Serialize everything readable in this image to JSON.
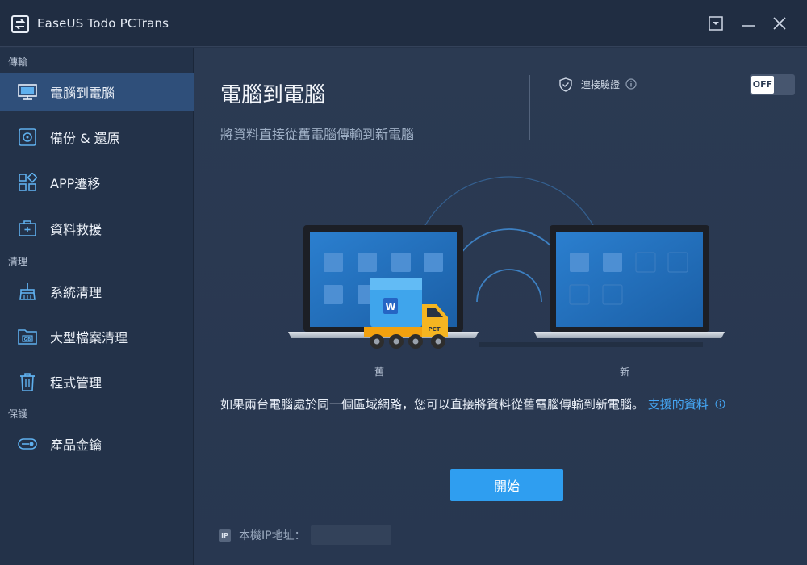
{
  "app": {
    "title": "EaseUS Todo PCTrans"
  },
  "sidebar": {
    "sections": [
      {
        "label": "傳輸"
      },
      {
        "label": "清理"
      },
      {
        "label": "保護"
      }
    ],
    "items": [
      {
        "label": "電腦到電腦",
        "icon": "monitor-icon",
        "active": true
      },
      {
        "label": "備份 & 還原",
        "icon": "backup-disk-icon",
        "active": false
      },
      {
        "label": "APP遷移",
        "icon": "apps-grid-icon",
        "active": false
      },
      {
        "label": "資料救援",
        "icon": "medical-kit-icon",
        "active": false
      },
      {
        "label": "系統清理",
        "icon": "broom-icon",
        "active": false
      },
      {
        "label": "大型檔案清理",
        "icon": "gb-folder-icon",
        "active": false
      },
      {
        "label": "程式管理",
        "icon": "trash-icon",
        "active": false
      },
      {
        "label": "產品金鑰",
        "icon": "key-icon",
        "active": false
      }
    ]
  },
  "main": {
    "title": "電腦到電腦",
    "subtitle": "將資料直接從舊電腦傳輸到新電腦",
    "verify": {
      "label": "連接驗證",
      "toggle_state": "OFF"
    },
    "illustration": {
      "old_label": "舊",
      "new_label": "新",
      "truck_label": "PCT"
    },
    "description": "如果兩台電腦處於同一個區域網路，您可以直接將資料從舊電腦傳輸到新電腦。",
    "support_link": "支援的資料",
    "start_button": "開始",
    "ip": {
      "badge": "IP",
      "label": "本機IP地址："
    }
  },
  "colors": {
    "accent": "#2f9ef0",
    "link": "#45a7f5",
    "sidebar_active": "#2f4f7a",
    "background": "#283750"
  }
}
